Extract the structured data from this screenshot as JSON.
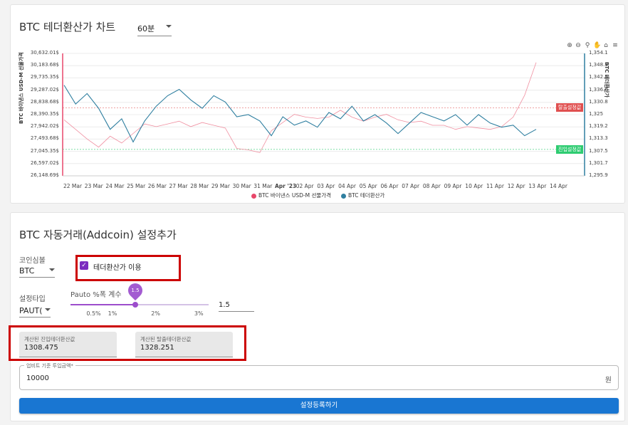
{
  "chart_card": {
    "title": "BTC 테더환산가 차트",
    "interval_value": "60분",
    "toolbar_icons": [
      "zoom-in-icon",
      "zoom-out-icon",
      "magnify-icon",
      "pan-hand-icon",
      "home-icon",
      "menu-icon"
    ]
  },
  "chart_data": {
    "type": "line",
    "left_axis_label": "BTC 바이낸스 USD-M 선물가격",
    "right_axis_label": "BTC 테더환산가",
    "left_ticks": [
      "30,632.01$",
      "30,183.68$",
      "29,735.35$",
      "29,287.02$",
      "28,838.68$",
      "28,390.35$",
      "27,942.02$",
      "27,493.68$",
      "27,045.35$",
      "26,597.02$",
      "26,148.69$"
    ],
    "right_ticks": [
      "1,354.1",
      "1,348.3",
      "1,342.5",
      "1,336.6",
      "1,330.8",
      "1,325",
      "1,319.2",
      "1,313.3",
      "1,307.5",
      "1,301.7",
      "1,295.9"
    ],
    "x_ticks": [
      "22 Mar",
      "23 Mar",
      "24 Mar",
      "25 Mar",
      "26 Mar",
      "27 Mar",
      "28 Mar",
      "29 Mar",
      "30 Mar",
      "31 Mar",
      "Apr '23",
      "02 Apr",
      "03 Apr",
      "04 Apr",
      "05 Apr",
      "06 Apr",
      "07 Apr",
      "08 Apr",
      "09 Apr",
      "10 Apr",
      "11 Apr",
      "12 Apr",
      "13 Apr",
      "14 Apr"
    ],
    "series": [
      {
        "name": "BTC 바이낸스 USD-M 선물가격",
        "color": "#f08fa0",
        "axis": "left",
        "values": [
          28200,
          27850,
          27500,
          27200,
          27600,
          27350,
          27700,
          28050,
          27950,
          28050,
          28150,
          27950,
          28100,
          28000,
          27900,
          27150,
          27100,
          27000,
          27800,
          28100,
          28400,
          28300,
          28250,
          28300,
          28550,
          28300,
          28150,
          28300,
          28400,
          28200,
          28100,
          28150,
          28000,
          28000,
          27850,
          27950,
          27900,
          27850,
          27950,
          28300,
          29100,
          30300
        ]
      },
      {
        "name": "BTC 테더환산가",
        "color": "#2f7fa0",
        "axis": "right",
        "values": [
          1339,
          1330,
          1335,
          1328,
          1318,
          1323,
          1312,
          1322,
          1329,
          1334,
          1337,
          1332,
          1328,
          1334,
          1331,
          1324,
          1325,
          1322,
          1315,
          1324,
          1320,
          1322,
          1319,
          1326,
          1323,
          1329,
          1322,
          1325,
          1321,
          1316,
          1321,
          1326,
          1324,
          1322,
          1325,
          1320,
          1325,
          1321,
          1319,
          1320,
          1315,
          1318
        ]
      }
    ],
    "annotations": [
      {
        "label": "탈출설정값",
        "value": 1328.251,
        "color": "#e05050"
      },
      {
        "label": "진입설정값",
        "value": 1308.475,
        "color": "#2ecc71"
      }
    ],
    "right_range": [
      1295.9,
      1354.1
    ],
    "left_range": [
      26148.69,
      30632.01
    ],
    "legend_placement": "bottom"
  },
  "form_card": {
    "title": "BTC 자동거래(Addcoin) 설정추가",
    "coin_label": "코인심볼",
    "coin_value": "BTC",
    "tether_checkbox_label": "테더환산가 이용",
    "tether_checked": true,
    "setting_type_label": "설정타입",
    "setting_type_value": "PAUT(",
    "slider_label": "Pauto %폭 계수",
    "slider_value_bubble": "1.5",
    "slider_value": 1.5,
    "slider_marks": [
      "0.5%",
      "1%",
      "2%",
      "3%"
    ],
    "slider_input_value": "1.5",
    "entry_label": "계산된 진입테더환산값",
    "entry_value": "1308.475",
    "exit_label": "계산된 탈출테더환산값",
    "exit_value": "1328.251",
    "amount_label": "업비트 기준 투입금액*",
    "amount_value": "10000",
    "amount_unit": "원",
    "submit_label": "설정등록하기"
  }
}
